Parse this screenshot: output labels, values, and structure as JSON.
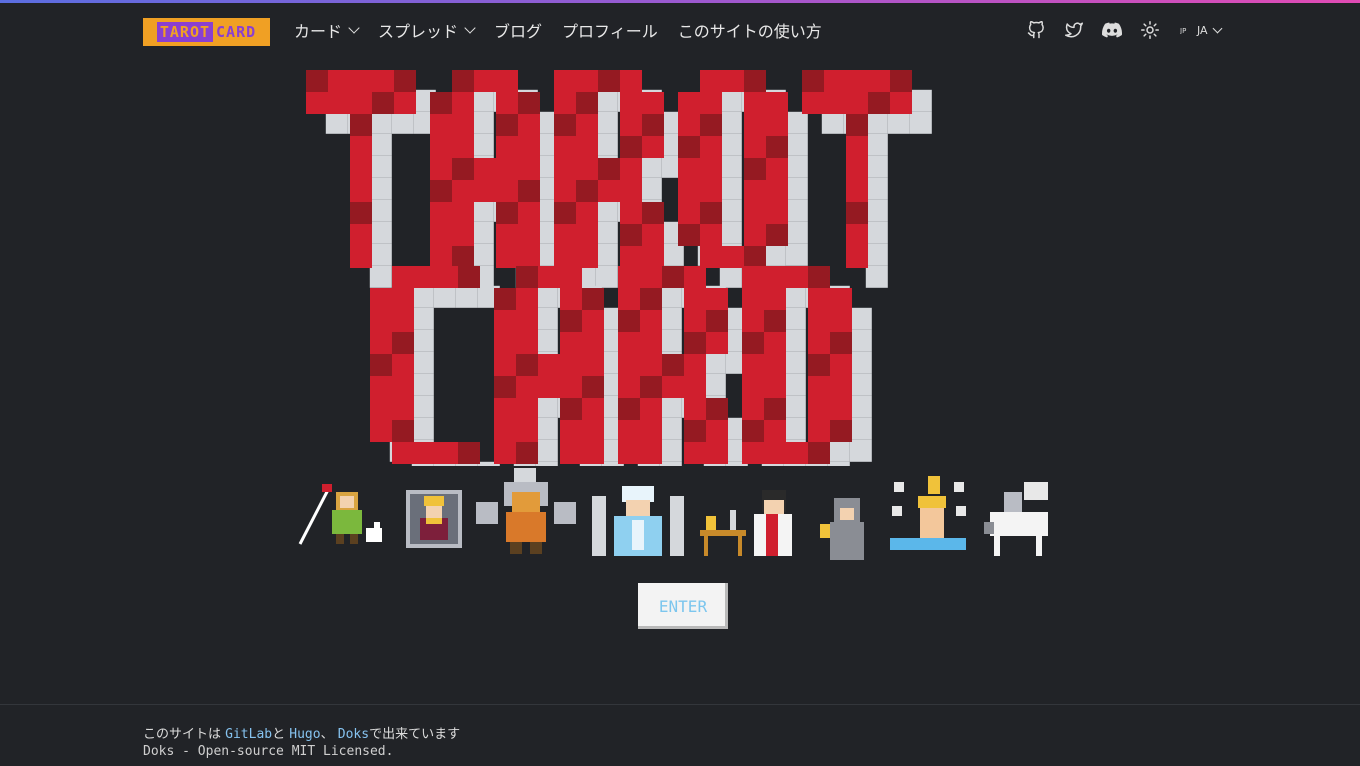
{
  "header": {
    "logo": {
      "part1": "TAROT",
      "part2": "CARD"
    },
    "nav": [
      {
        "label": "カード",
        "has_dropdown": true
      },
      {
        "label": "スプレッド",
        "has_dropdown": true
      },
      {
        "label": "ブログ",
        "has_dropdown": false
      },
      {
        "label": "プロフィール",
        "has_dropdown": false
      },
      {
        "label": "このサイトの使い方",
        "has_dropdown": false
      }
    ],
    "icons": [
      "github-icon",
      "twitter-icon",
      "discord-icon",
      "theme-toggle-icon"
    ],
    "language": "JA"
  },
  "hero": {
    "title_lines": [
      "TAROT",
      "CARD"
    ],
    "colors": {
      "red": "#d01f2e",
      "dark_red": "#951a22",
      "shadow": "#d5d8dc"
    }
  },
  "characters": [
    "fool",
    "emperor",
    "dwarf",
    "high-priestess",
    "magician",
    "hermit",
    "star",
    "knight"
  ],
  "enter_button": "ENTER",
  "footer": {
    "line1_prefix": "このサイトは",
    "gitlab": "GitLab",
    "and": "と",
    "hugo": "Hugo",
    "sep": "、",
    "doks": "Doks",
    "suffix": "で出来ています",
    "line2": "Doks - Open-source MIT Licensed."
  },
  "accent_colors": {
    "topbar_start": "#5b6ee1",
    "topbar_end": "#e14bb4",
    "logo_bg": "#f0a024",
    "logo_purple": "#8a3fd1",
    "link": "#86c3f0"
  }
}
